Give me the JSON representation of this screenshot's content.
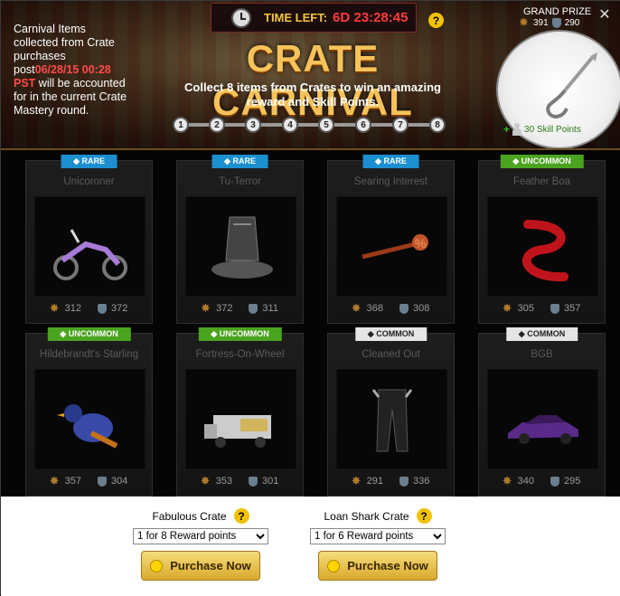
{
  "header": {
    "note_prefix": "Carnival Items collected from Crate purchases post",
    "note_date": "06/28/15 00:28 PST",
    "note_suffix": " will be accounted for in the current Crate Mastery round.",
    "timer_label": "TIME LEFT:",
    "timer_value": "6D 23:28:45",
    "title": "CRATE CARNIVAL",
    "subtitle": "Collect 8 items from Crates to win an amazing reward and Skill Points.",
    "steps": [
      "1",
      "2",
      "3",
      "4",
      "5",
      "6",
      "7",
      "8"
    ],
    "grand_prize_label": "GRAND PRIZE",
    "grand_prize_attack": "391",
    "grand_prize_defense": "290",
    "skill_points": "30 Skill Points"
  },
  "items": [
    {
      "rarity": "RARE",
      "rarity_class": "rare",
      "name": "Unicoroner",
      "attack": "312",
      "defense": "372",
      "icon": "motorcycle-icon"
    },
    {
      "rarity": "RARE",
      "rarity_class": "rare",
      "name": "Tu-Terror",
      "attack": "372",
      "defense": "311",
      "icon": "armor-icon"
    },
    {
      "rarity": "RARE",
      "rarity_class": "rare",
      "name": "Searing Interest",
      "attack": "368",
      "defense": "308",
      "icon": "branding-iron-icon"
    },
    {
      "rarity": "UNCOMMON",
      "rarity_class": "uncommon",
      "name": "Feather Boa",
      "attack": "305",
      "defense": "357",
      "icon": "feather-boa-icon"
    },
    {
      "rarity": "UNCOMMON",
      "rarity_class": "uncommon",
      "name": "Hildebrandt's Starling",
      "attack": "357",
      "defense": "304",
      "icon": "bird-icon"
    },
    {
      "rarity": "UNCOMMON",
      "rarity_class": "uncommon",
      "name": "Fortress-On-Wheel",
      "attack": "353",
      "defense": "301",
      "icon": "truck-icon"
    },
    {
      "rarity": "COMMON",
      "rarity_class": "common",
      "name": "Cleaned Out",
      "attack": "291",
      "defense": "336",
      "icon": "pants-icon"
    },
    {
      "rarity": "COMMON",
      "rarity_class": "common",
      "name": "BGB",
      "attack": "340",
      "defense": "295",
      "icon": "car-icon"
    }
  ],
  "footer": {
    "crates": [
      {
        "title": "Fabulous Crate",
        "select_value": "1 for 8 Reward points",
        "button": "Purchase Now"
      },
      {
        "title": "Loan Shark Crate",
        "select_value": "1 for 6 Reward points",
        "button": "Purchase Now"
      }
    ]
  },
  "colors": {
    "rare": "#1b8fd0",
    "uncommon": "#4aa41f",
    "common": "#e5e5e5",
    "timer": "#ff3b3b",
    "title": "#f6c35a"
  }
}
